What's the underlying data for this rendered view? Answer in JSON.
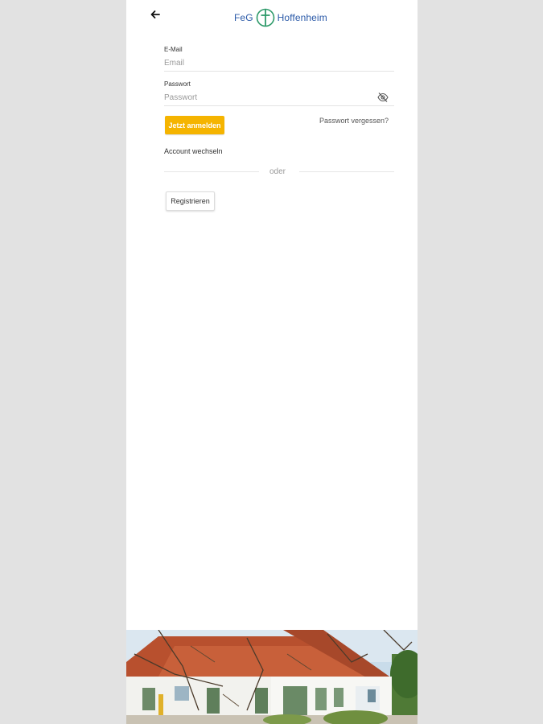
{
  "header": {
    "back_icon": "arrow-left-icon",
    "logo_left": "FeG",
    "logo_right": "Hoffenheim",
    "logo_icon": "cross-circle-icon"
  },
  "form": {
    "email_label": "E-Mail",
    "email_placeholder": "Email",
    "password_label": "Passwort",
    "password_placeholder": "Passwort",
    "password_visibility_icon": "eye-off-icon",
    "login_button": "Jetzt anmelden",
    "forgot_password": "Passwort vergessen?",
    "switch_account": "Account wechseln",
    "divider": "oder",
    "register_button": "Registrieren"
  },
  "colors": {
    "accent": "#f5b400",
    "logo_blue": "#2b5aa8",
    "logo_green": "#2e9a6a",
    "background": "#e2e2e2"
  }
}
